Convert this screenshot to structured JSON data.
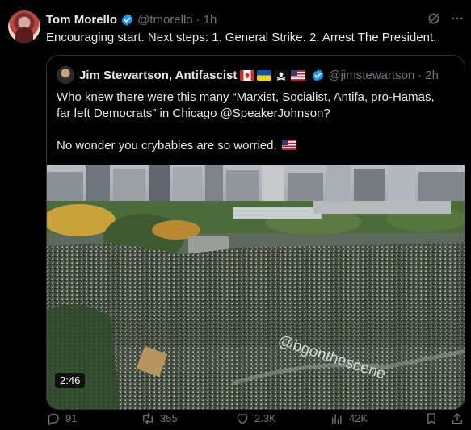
{
  "post": {
    "author_name": "Tom Morello",
    "author_handle": "@tmorello",
    "time": "1h",
    "text": "Encouraging start. Next steps: 1. General  Strike. 2. Arrest The President."
  },
  "quote": {
    "author_name": "Jim Stewartson, Antifascist",
    "flags": [
      "canada-flag",
      "ukraine-flag",
      "pirate-flag",
      "us-flag"
    ],
    "author_handle": "@jimstewartson",
    "time": "2h",
    "text_line1": "Who knew there were this many “Marxist, Socialist, Antifa, pro-Hamas,",
    "text_line2": "far left Democrats” in Chicago @SpeakerJohnson?",
    "text_line3": "No wonder you crybabies are so worried.",
    "video": {
      "duration": "2:46",
      "watermark": "@bgonthescene"
    }
  },
  "actions": {
    "replies": "91",
    "reposts": "355",
    "likes": "2.3K",
    "views": "42K"
  },
  "colors": {
    "background": "#000000",
    "text": "#e7e9ea",
    "muted": "#71767b",
    "border": "#2f3336",
    "verified": "#1d9bf0"
  }
}
